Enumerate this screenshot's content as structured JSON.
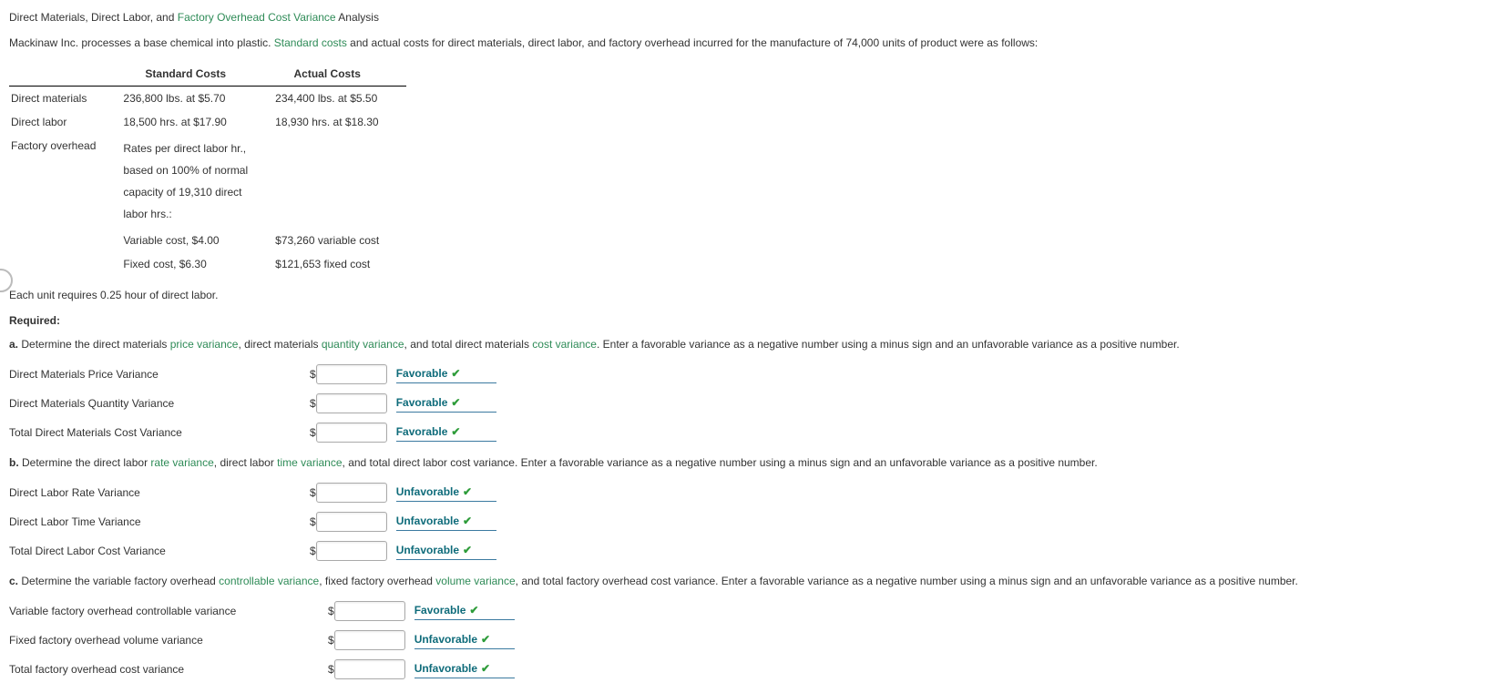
{
  "title": {
    "pre": "Direct Materials, Direct Labor, and ",
    "term": "Factory Overhead Cost Variance",
    "post": " Analysis"
  },
  "intro": {
    "pre": "Mackinaw Inc. processes a base chemical into plastic. ",
    "term": "Standard costs",
    "post": " and actual costs for direct materials, direct labor, and factory overhead incurred for the manufacture of 74,000 units of product were as follows:"
  },
  "table": {
    "hdr_std": "Standard Costs",
    "hdr_act": "Actual Costs",
    "rows": {
      "dm_label": "Direct materials",
      "dm_std": "236,800 lbs. at $5.70",
      "dm_act": "234,400 lbs. at $5.50",
      "dl_label": "Direct labor",
      "dl_std": "18,500 hrs. at $17.90",
      "dl_act": "18,930 hrs. at $18.30",
      "fo_label": "Factory overhead",
      "fo_std_l1": "Rates per direct labor hr.,",
      "fo_std_l2": "based on 100% of normal",
      "fo_std_l3": "capacity of 19,310 direct",
      "fo_std_l4": "labor hrs.:",
      "fo_var_std": "Variable cost, $4.00",
      "fo_var_act": "$73,260 variable cost",
      "fo_fix_std": "Fixed cost, $6.30",
      "fo_fix_act": "$121,653 fixed cost"
    }
  },
  "note": "Each unit requires 0.25 hour of direct labor.",
  "required_label": "Required:",
  "qa": {
    "letter": "a.",
    "pre1": "  Determine the direct materials ",
    "term1": "price variance",
    "mid1": ", direct materials ",
    "term2": "quantity variance",
    "mid2": ", and total direct materials ",
    "term3": "cost variance",
    "post": ". Enter a favorable variance as a negative number using a minus sign and an unfavorable variance as a positive number.",
    "rows": [
      {
        "label": "Direct Materials Price Variance",
        "result": "Favorable"
      },
      {
        "label": "Direct Materials Quantity Variance",
        "result": "Favorable"
      },
      {
        "label": "Total Direct Materials Cost Variance",
        "result": "Favorable"
      }
    ]
  },
  "qb": {
    "letter": "b.",
    "pre1": "  Determine the direct labor ",
    "term1": "rate variance",
    "mid1": ", direct labor ",
    "term2": "time variance",
    "post": ", and total direct labor cost variance. Enter a favorable variance as a negative number using a minus sign and an unfavorable variance as a positive number.",
    "rows": [
      {
        "label": "Direct Labor Rate Variance",
        "result": "Unfavorable"
      },
      {
        "label": "Direct Labor Time Variance",
        "result": "Unfavorable"
      },
      {
        "label": "Total Direct Labor Cost Variance",
        "result": "Unfavorable"
      }
    ]
  },
  "qc": {
    "letter": "c.",
    "pre1": "  Determine the variable factory overhead ",
    "term1": "controllable variance",
    "mid1": ", fixed factory overhead ",
    "term2": "volume variance",
    "post": ", and total factory overhead cost variance. Enter a favorable variance as a negative number using a minus sign and an unfavorable variance as a positive number.",
    "rows": [
      {
        "label": "Variable factory overhead controllable variance",
        "result": "Favorable"
      },
      {
        "label": "Fixed factory overhead volume variance",
        "result": "Unfavorable"
      },
      {
        "label": "Total factory overhead cost variance",
        "result": "Unfavorable"
      }
    ]
  },
  "dollar": "$",
  "check": "✔"
}
